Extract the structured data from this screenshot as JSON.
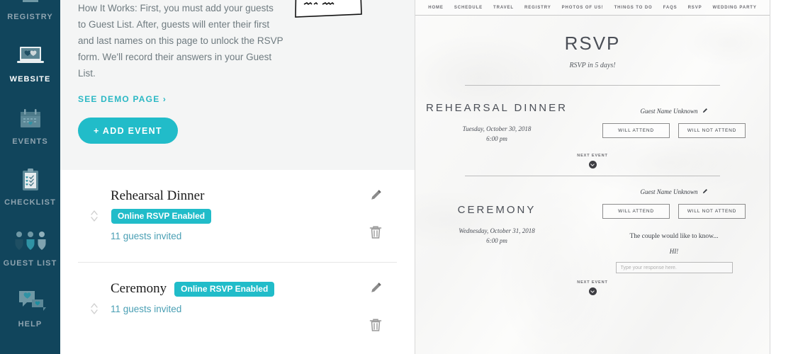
{
  "sidebar": {
    "items": [
      {
        "label": "REGISTRY",
        "icon": "gift-icon",
        "active": false
      },
      {
        "label": "WEBSITE",
        "icon": "laptop-icon",
        "active": true
      },
      {
        "label": "EVENTS",
        "icon": "calendar-icon",
        "active": false
      },
      {
        "label": "CHECKLIST",
        "icon": "clipboard-icon",
        "active": false
      },
      {
        "label": "GUEST LIST",
        "icon": "people-icon",
        "active": false
      },
      {
        "label": "HELP",
        "icon": "chat-bubbles-icon",
        "active": false
      }
    ]
  },
  "main": {
    "how_it_works": "How It Works: First, you must add your guests to Guest List. After, guests will enter their first and last names on this page to unlock the RSVP form. We'll record their answers in your Guest List.",
    "demo_link": "SEE DEMO PAGE ›",
    "add_event_button": "+ ADD EVENT",
    "card_illustration": "rsvp-card-illustration",
    "events": [
      {
        "title": "Rehearsal Dinner",
        "badge": "Online RSVP Enabled",
        "badge_inline": false,
        "guests": "11 guests invited",
        "edit_icon": "pencil-icon",
        "delete_icon": "trash-icon",
        "drag_icon": "drag-handle-icon"
      },
      {
        "title": "Ceremony",
        "badge": "Online RSVP Enabled",
        "badge_inline": true,
        "guests": "11 guests invited",
        "edit_icon": "pencil-icon",
        "delete_icon": "trash-icon",
        "drag_icon": "drag-handle-icon"
      }
    ]
  },
  "preview": {
    "nav": [
      "HOME",
      "SCHEDULE",
      "TRAVEL",
      "REGISTRY",
      "PHOTOS OF US!",
      "THINGS TO DO",
      "FAQS",
      "RSVP",
      "WEDDING PARTY"
    ],
    "title": "RSVP",
    "subtitle": "RSVP in 5 days!",
    "events": [
      {
        "name": "REHEARSAL DINNER",
        "date": "Tuesday, October 30, 2018",
        "time": "6:00 pm",
        "guest_name": "Guest Name Unknown",
        "edit_icon": "pencil-icon",
        "attend_yes": "WILL ATTEND",
        "attend_no": "WILL NOT ATTEND",
        "next_event_label": "NEXT EVENT",
        "has_question": false
      },
      {
        "name": "CEREMONY",
        "date": "Wednesday, October 31, 2018",
        "time": "6:00 pm",
        "guest_name": "Guest Name Unknown",
        "edit_icon": "pencil-icon",
        "attend_yes": "WILL ATTEND",
        "attend_no": "WILL NOT ATTEND",
        "next_event_label": "NEXT EVENT",
        "has_question": true,
        "question_intro": "The couple would like to know...",
        "question_text": "HI!",
        "response_placeholder": "Type your response here."
      }
    ]
  },
  "colors": {
    "sidebar_bg": "#11455c",
    "accent_teal": "#21bcc9",
    "link_blue": "#4a9fb4",
    "panel_grey": "#f4f5f5"
  }
}
